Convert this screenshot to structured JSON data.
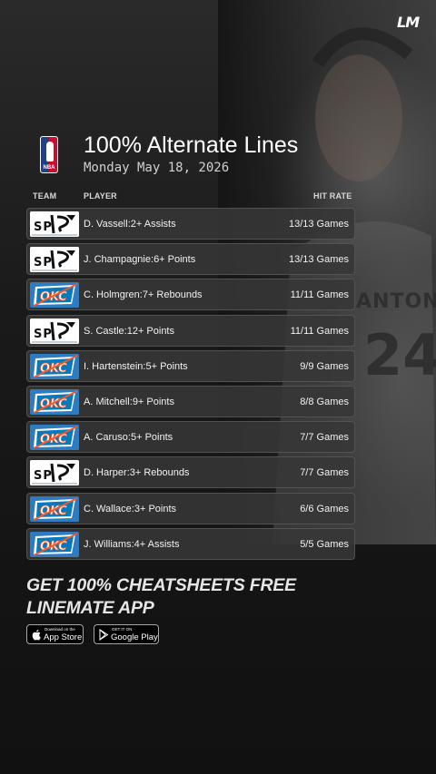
{
  "brand": {
    "logo_text": "LM"
  },
  "header": {
    "title": "100% Alternate Lines",
    "date": "Monday May 18, 2026",
    "league_logo": "nba-logo"
  },
  "columns": {
    "team": "TEAM",
    "player": "PLAYER",
    "hit_rate": "HIT RATE"
  },
  "rows": [
    {
      "team": "sas",
      "player": "D. Vassell",
      "line": "2+ Assists",
      "hit": "13/13 Games"
    },
    {
      "team": "sas",
      "player": "J. Champagnie",
      "line": "6+ Points",
      "hit": "13/13 Games"
    },
    {
      "team": "okc",
      "player": "C. Holmgren",
      "line": "7+ Rebounds",
      "hit": "11/11 Games"
    },
    {
      "team": "sas",
      "player": "S. Castle",
      "line": "12+ Points",
      "hit": "11/11 Games"
    },
    {
      "team": "okc",
      "player": "I. Hartenstein",
      "line": "5+ Points",
      "hit": "9/9 Games"
    },
    {
      "team": "okc",
      "player": "A. Mitchell",
      "line": "9+ Points",
      "hit": "8/8 Games"
    },
    {
      "team": "okc",
      "player": "A. Caruso",
      "line": "5+ Points",
      "hit": "7/7 Games"
    },
    {
      "team": "sas",
      "player": "D. Harper",
      "line": "3+ Rebounds",
      "hit": "7/7 Games"
    },
    {
      "team": "okc",
      "player": "C. Wallace",
      "line": "3+ Points",
      "hit": "6/6 Games"
    },
    {
      "team": "okc",
      "player": "J. Williams",
      "line": "4+ Assists",
      "hit": "5/5 Games"
    }
  ],
  "cta": {
    "line1": "GET 100% CHEATSHEETS FREE",
    "line2": "LINEMATE APP"
  },
  "stores": {
    "apple": {
      "small": "Download on the",
      "big": "App Store"
    },
    "google": {
      "small": "GET IT ON",
      "big": "Google Play"
    }
  },
  "background": {
    "jersey_text": "ANTONI",
    "jersey_number": "24"
  },
  "colors": {
    "okc_blue": "#2f7bbf",
    "okc_orange": "#ef5a2a",
    "row_bg": "#373737",
    "page_bg": "#141414"
  }
}
